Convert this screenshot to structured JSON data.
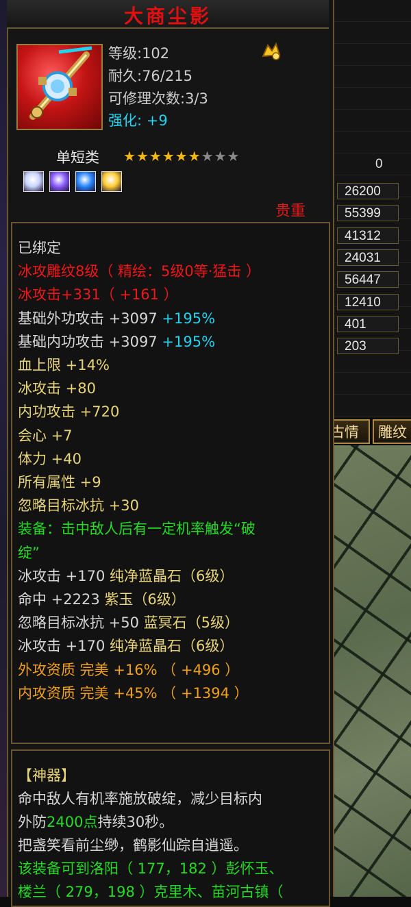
{
  "item": {
    "title": "大商尘影",
    "level": "等级:102",
    "durability": "耐久:76/215",
    "repair_count": "可修理次数:3/3",
    "enhance_label": "强化:",
    "enhance_value": "+9",
    "category": "单短类",
    "stars_filled": 6,
    "stars_total": 9,
    "rarity": "贵重",
    "icon": "sword-icon",
    "badge_icon": "gold-emblem-icon"
  },
  "sockets": [
    {
      "name": "white-gem-icon",
      "color": "#c9d4ff"
    },
    {
      "name": "purple-gem-icon",
      "color": "#8a5cff"
    },
    {
      "name": "blue-gem-icon",
      "color": "#2a86ff"
    },
    {
      "name": "gold-gem-icon",
      "color": "#ffcc33"
    }
  ],
  "attributes": [
    {
      "text": "已绑定",
      "color": "white"
    },
    {
      "text": "冰攻雕纹8级（ 精绘：5级0等·猛击 ）",
      "color": "red"
    },
    {
      "text": "冰攻击+331（ +161 ）",
      "color": "red"
    },
    {
      "text": "基础外功攻击 +3097",
      "extra": " +195%",
      "color": "white"
    },
    {
      "text": "基础内功攻击 +3097",
      "extra": " +195%",
      "color": "white"
    },
    {
      "text": "血上限 +14%",
      "color": "yellow"
    },
    {
      "text": "冰攻击 +80",
      "color": "yellow"
    },
    {
      "text": "内功攻击 +720",
      "color": "yellow"
    },
    {
      "text": "会心 +7",
      "color": "yellow"
    },
    {
      "text": "体力 +40",
      "color": "yellow"
    },
    {
      "text": "所有属性 +9",
      "color": "yellow"
    },
    {
      "text": "忽略目标冰抗 +30",
      "color": "yellow"
    },
    {
      "text": "装备：击中敌人后有一定机率触发“破",
      "color": "green"
    },
    {
      "text": "绽”",
      "color": "green"
    },
    {
      "text": "冰攻击 +170",
      "extra": " 纯净蓝晶石（6级）",
      "color": "white"
    },
    {
      "text": "命中 +2223",
      "extra": " 紫玉（6级）",
      "color": "white"
    },
    {
      "text": "忽略目标冰抗 +50",
      "extra": " 蓝冥石（5级）",
      "color": "white"
    },
    {
      "text": "冰攻击 +170",
      "extra": " 纯净蓝晶石（6级）",
      "color": "white"
    },
    {
      "text": "外攻资质  完美 +16% （ +496 ）",
      "color": "orange"
    },
    {
      "text": "内攻资质  完美 +45% （ +1394 ）",
      "color": "orange"
    }
  ],
  "artifact": {
    "heading": "【神器】",
    "desc1": "命中敌人有机率施放破绽，减少目标内",
    "desc2a": "外防",
    "desc2b": "2400点",
    "desc2c": "持续30秒。",
    "poem": "把盏笑看前尘缈，鹤影仙踪自逍遥。",
    "location1": "该装备可到洛阳（ 177，182 ）彭怀玉、",
    "location2": "楼兰（ 279，198 ）克里木、苗河古镇（"
  },
  "side_stats": {
    "zero": "0",
    "values": [
      "26200",
      "55399",
      "41312",
      "24031",
      "56447",
      "12410",
      "401",
      "203"
    ]
  },
  "side_tabs": [
    "古情",
    "雕纹"
  ]
}
